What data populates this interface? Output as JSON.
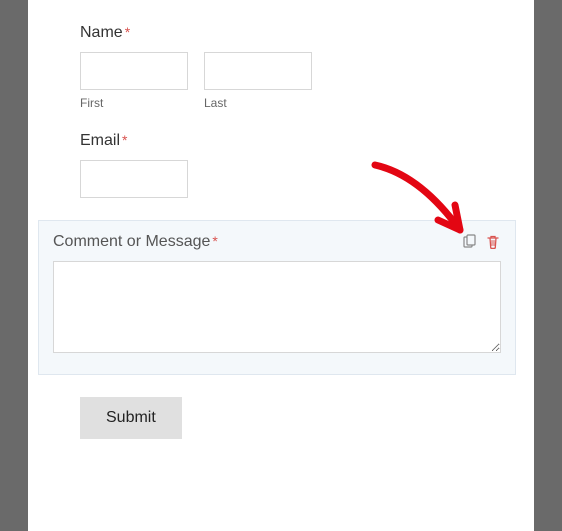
{
  "form": {
    "name": {
      "label": "Name",
      "required_mark": "*",
      "first_sublabel": "First",
      "last_sublabel": "Last"
    },
    "email": {
      "label": "Email",
      "required_mark": "*"
    },
    "comment": {
      "label": "Comment or Message",
      "required_mark": "*",
      "icons": {
        "duplicate": "duplicate-icon",
        "delete": "trash-icon"
      }
    },
    "submit_label": "Submit"
  },
  "colors": {
    "required": "#d9534f",
    "panel_bg": "#ffffff",
    "page_bg": "#6a6a6a",
    "highlight_bg": "#f4f8fb",
    "arrow": "#e30613"
  }
}
